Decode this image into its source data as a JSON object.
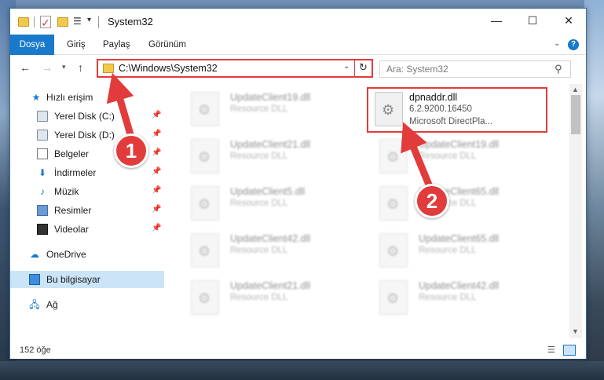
{
  "window": {
    "title": "System32"
  },
  "ribbon": {
    "tabs": [
      "Dosya",
      "Giriş",
      "Paylaş",
      "Görünüm"
    ]
  },
  "address": {
    "path": "C:\\Windows\\System32"
  },
  "search": {
    "placeholder": "Ara: System32"
  },
  "sidebar": {
    "quick_access": "Hızlı erişim",
    "items": [
      {
        "label": "Yerel Disk (C:)",
        "icon": "drive-icon",
        "pinned": true
      },
      {
        "label": "Yerel Disk (D:)",
        "icon": "drive-icon",
        "pinned": true
      },
      {
        "label": "Belgeler",
        "icon": "documents-icon",
        "pinned": true
      },
      {
        "label": "İndirmeler",
        "icon": "downloads-icon",
        "pinned": true
      },
      {
        "label": "Müzik",
        "icon": "music-icon",
        "pinned": true
      },
      {
        "label": "Resimler",
        "icon": "pictures-icon",
        "pinned": true
      },
      {
        "label": "Videolar",
        "icon": "videos-icon",
        "pinned": true
      }
    ],
    "onedrive": "OneDrive",
    "this_pc": "Bu bilgisayar",
    "network": "Ağ"
  },
  "files": {
    "left": [
      {
        "name": "UpdateClient19.dll",
        "type": "Resource DLL"
      },
      {
        "name": "UpdateClient21.dll",
        "type": "Resource DLL"
      },
      {
        "name": "UpdateClient5.dll",
        "type": "Resource DLL"
      },
      {
        "name": "UpdateClient42.dll",
        "type": "Resource DLL"
      },
      {
        "name": "UpdateClient21.dll",
        "type": "Resource DLL"
      }
    ],
    "right": [
      {
        "name": "dpnaddr.dll",
        "version": "6.2.9200.16450",
        "description": "Microsoft DirectPla..."
      },
      {
        "name": "UpdateClient19.dll",
        "type": "Resource DLL"
      },
      {
        "name": "UpdateClient65.dll",
        "type": "Resource DLL"
      },
      {
        "name": "UpdateClient65.dll",
        "type": "Resource DLL"
      },
      {
        "name": "UpdateClient42.dll",
        "type": "Resource DLL"
      }
    ]
  },
  "status": {
    "item_count": "152 öğe"
  },
  "callouts": {
    "one": "1",
    "two": "2"
  },
  "colors": {
    "accent": "#1979ca",
    "highlight": "#e43a3a"
  }
}
